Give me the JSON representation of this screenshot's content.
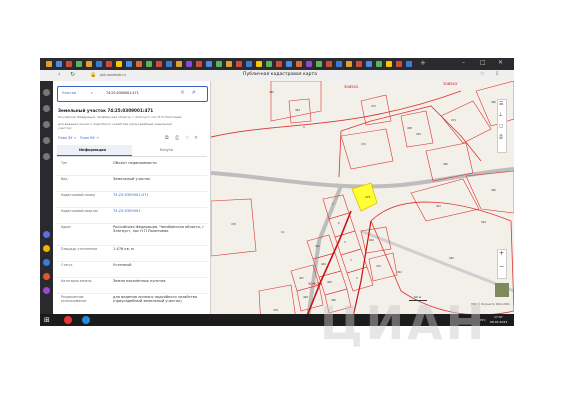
{
  "window": {
    "title": "Публичная кадастровая карта",
    "url": "pkk.rosreestr.ru"
  },
  "search": {
    "type_label": "Участки",
    "query": "74:25:0309001:471"
  },
  "parcel": {
    "heading": "Земельный участок 74:25:0309001:471",
    "address_line": "Российская Федерация, Челябинская область, г Златоуст, пос Н П Политиева",
    "use_line": "для ведения личного подсобного хозяйства (приусадебный земельный участок)",
    "link_zu": "План ЗУ →",
    "link_kk": "План КК →"
  },
  "tabs": {
    "info": "Информация",
    "services": "Услуги"
  },
  "fields": [
    {
      "key": "Тип",
      "value": "Объект недвижимости"
    },
    {
      "key": "Вид",
      "value": "Земельный участок"
    },
    {
      "key": "Кадастровый номер",
      "value": "74:25:0309001:471"
    },
    {
      "key": "Кадастровый квартал",
      "value": "74:25:0309001"
    },
    {
      "key": "Адрес",
      "value": "Российская Федерация, Челябинская область, г Златоуст, пос Н П Политиева"
    },
    {
      "key": "Площадь уточненная",
      "value": "1 476 кв. м"
    },
    {
      "key": "Статус",
      "value": "Учтенный"
    },
    {
      "key": "Категория земель",
      "value": "Земли населённых пунктов"
    },
    {
      "key": "Разрешенное использование",
      "value": "для ведения личного подсобного хозяйства (приусадебный земельный участок)"
    },
    {
      "key": "Форма собственности",
      "value": "–"
    },
    {
      "key": "Кадастровая стоимость",
      "value": "611 169,64 руб."
    }
  ],
  "map": {
    "quarter_labels": [
      "308502",
      "309001",
      "308502"
    ],
    "parcel_number": "471",
    "scale": "60 м",
    "copyright": "ПКК © Росреестр 2010-2021",
    "lot_numbers": [
      "4",
      "10",
      "7",
      "6",
      "5",
      "3",
      "2",
      "459",
      "460",
      "461",
      "462",
      "464",
      "465",
      "466",
      "467",
      "468",
      "469",
      "470",
      "472",
      "473",
      "474",
      "476",
      "478",
      "480",
      "482",
      "484",
      "486",
      "488",
      "490",
      "492",
      "494"
    ]
  },
  "taskbar": {
    "time": "17:07",
    "date": "08.03.2023",
    "lang": "РУС"
  },
  "watermark": "ЦИАН"
}
